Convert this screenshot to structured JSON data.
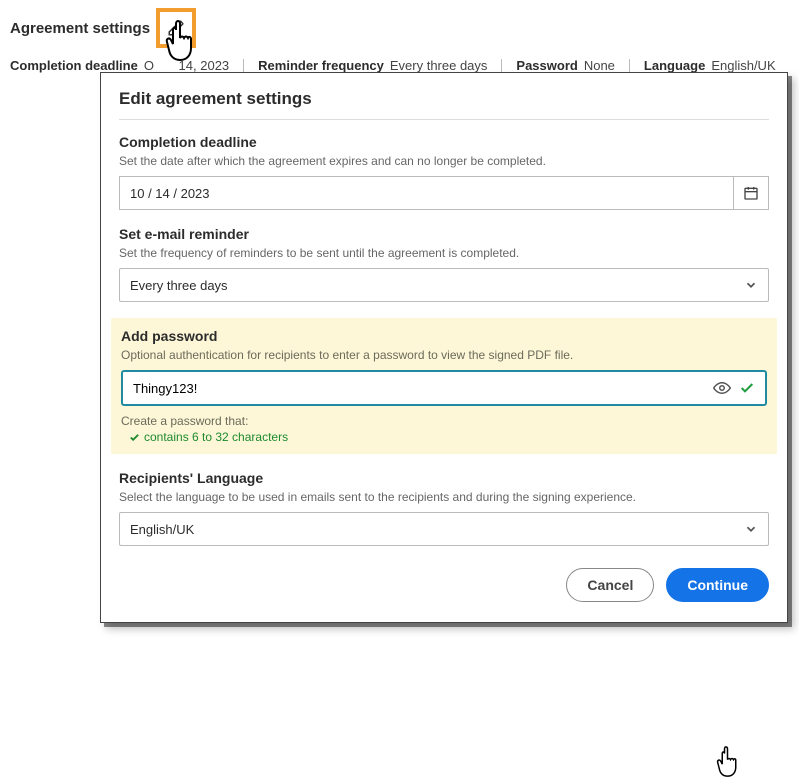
{
  "header": {
    "title": "Agreement settings",
    "summary": {
      "deadline_label": "Completion deadline",
      "deadline_value": "Oct 14, 2023",
      "deadline_value_partial_a": "O",
      "deadline_value_partial_b": "14, 2023",
      "reminder_label": "Reminder frequency",
      "reminder_value": "Every three days",
      "password_label": "Password",
      "password_value": "None",
      "language_label": "Language",
      "language_value": "English/UK"
    }
  },
  "dialog": {
    "title": "Edit agreement settings",
    "deadline": {
      "title": "Completion deadline",
      "desc": "Set the date after which the agreement expires and can no longer be completed.",
      "value": "10 / 14 / 2023"
    },
    "reminder": {
      "title": "Set e-mail reminder",
      "desc": "Set the frequency of reminders to be sent until the agreement is completed.",
      "value": "Every three days"
    },
    "password": {
      "title": "Add password",
      "desc": "Optional authentication for recipients to enter a password to view the signed PDF file.",
      "value": "Thingy123!",
      "hint_label": "Create a password that:",
      "hint_ok": "contains 6 to 32 characters"
    },
    "language": {
      "title": "Recipients' Language",
      "desc": "Select the language to be used in emails sent to the recipients and during the signing experience.",
      "value": "English/UK"
    },
    "cancel_label": "Cancel",
    "continue_label": "Continue"
  }
}
